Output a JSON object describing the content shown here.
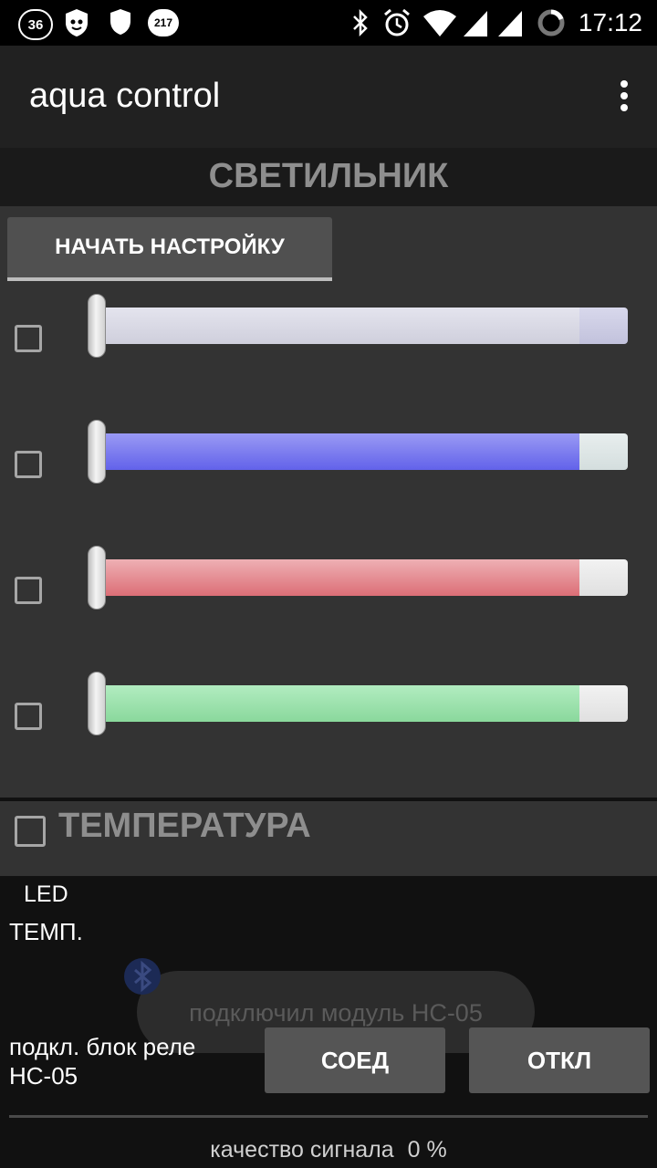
{
  "status_bar": {
    "badge_left": "36",
    "badge_right": "217",
    "time": "17:12",
    "icons": [
      "notification-36-icon",
      "shield-cat-icon",
      "shield-icon",
      "notification-217-icon",
      "bluetooth-icon",
      "alarm-icon",
      "wifi-icon",
      "signal-icon",
      "signal-icon",
      "battery-icon"
    ]
  },
  "app_bar": {
    "title": "aqua control",
    "menu_icon": "overflow-menu-icon"
  },
  "lamp_section": {
    "header": "СВЕТИЛЬНИК",
    "start_button": "НАЧАТЬ НАСТРОЙКУ",
    "channels": [
      {
        "checked": false,
        "level": 0,
        "fill_color": "#dcdce6"
      },
      {
        "checked": false,
        "level": 0,
        "fill_color": "#7a7af0"
      },
      {
        "checked": false,
        "level": 0,
        "fill_color": "#e07f86"
      },
      {
        "checked": false,
        "level": 0,
        "fill_color": "#9adea8"
      }
    ]
  },
  "temperature_section": {
    "label": "ТЕМПЕРАТУРА",
    "checked": false
  },
  "readouts": {
    "led": "LED",
    "temp": "ТЕМП."
  },
  "toast": {
    "message": "подключил модуль HC-05"
  },
  "relay": {
    "label_line1": "подкл. блок реле",
    "label_line2": "HC-05",
    "connect_button": "СОЕД",
    "disconnect_button": "ОТКЛ"
  },
  "signal": {
    "label": "качество сигнала",
    "value": "0 %"
  }
}
